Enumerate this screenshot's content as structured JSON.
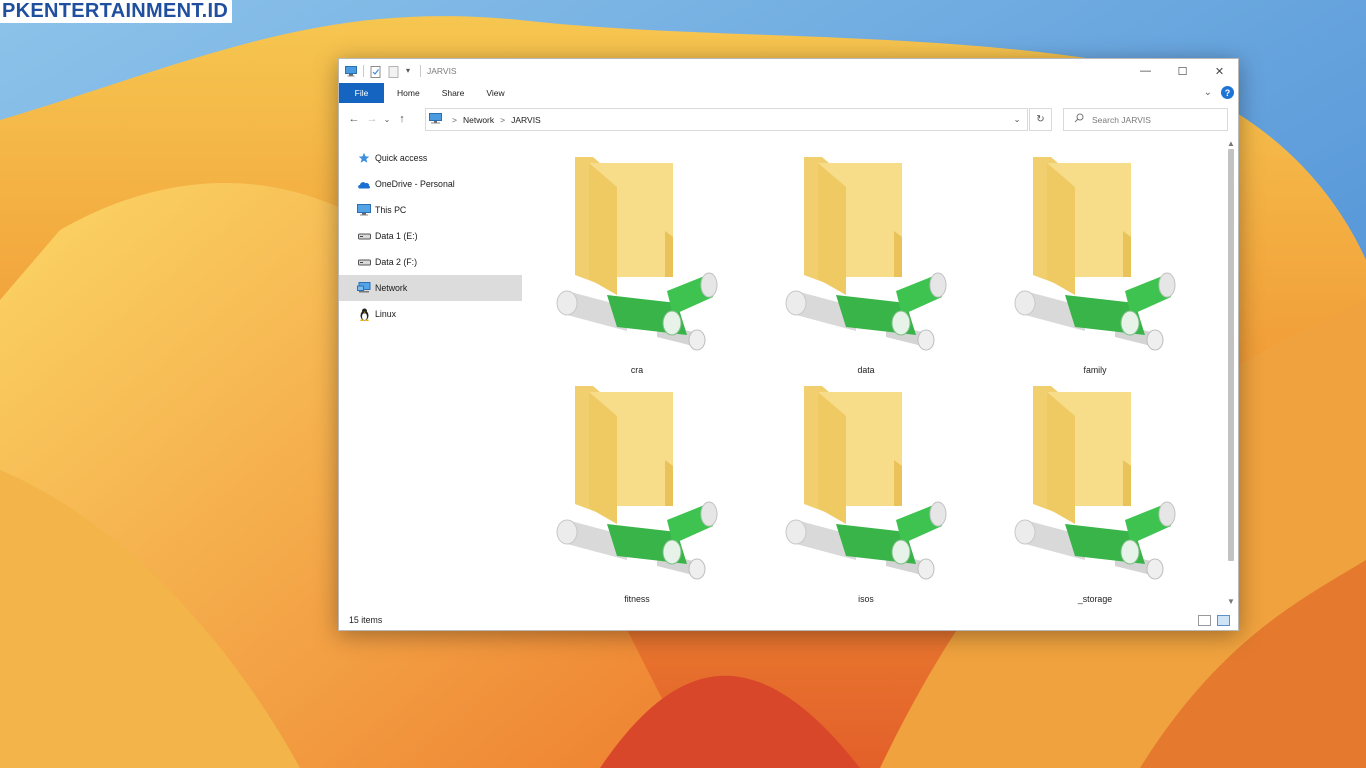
{
  "watermark": {
    "text": "PKENTERTAINMENT.ID"
  },
  "window": {
    "title": "JARVIS",
    "controls": {
      "minimize": "—",
      "maximize": "☐",
      "close": "✕"
    }
  },
  "ribbon": {
    "tabs": [
      {
        "label": "File"
      },
      {
        "label": "Home"
      },
      {
        "label": "Share"
      },
      {
        "label": "View"
      }
    ],
    "expand_glyph": "⌄",
    "help_glyph": "?"
  },
  "address": {
    "back": "←",
    "forward": "→",
    "recent": "⌄",
    "up": "↑",
    "crumbs": [
      "Network",
      "JARVIS"
    ],
    "crumb_separator": ">",
    "dropdown": "⌄",
    "refresh": "↻"
  },
  "search": {
    "placeholder": "Search JARVIS",
    "icon": "search-icon"
  },
  "nav_pane": {
    "items": [
      {
        "label": "Quick access",
        "icon": "star-icon"
      },
      {
        "label": "OneDrive - Personal",
        "icon": "cloud-icon"
      },
      {
        "label": "This PC",
        "icon": "monitor-icon"
      },
      {
        "label": "Data 1 (E:)",
        "icon": "drive-icon"
      },
      {
        "label": "Data 2 (F:)",
        "icon": "drive-icon"
      },
      {
        "label": "Network",
        "icon": "network-icon",
        "selected": true
      },
      {
        "label": "Linux",
        "icon": "penguin-icon"
      }
    ]
  },
  "items": [
    {
      "label": "cra",
      "icon": "network-share-folder-icon"
    },
    {
      "label": "data",
      "icon": "network-share-folder-icon"
    },
    {
      "label": "family",
      "icon": "network-share-folder-icon"
    },
    {
      "label": "fitness",
      "icon": "network-share-folder-icon"
    },
    {
      "label": "isos",
      "icon": "network-share-folder-icon"
    },
    {
      "label": "_storage",
      "icon": "network-share-folder-icon"
    }
  ],
  "status": {
    "item_count": "15 items"
  },
  "colors": {
    "accent": "#1565c0",
    "folder": "#f5d77c",
    "pipe_green": "#3cbf4a",
    "selection": "#dcdcdc"
  }
}
